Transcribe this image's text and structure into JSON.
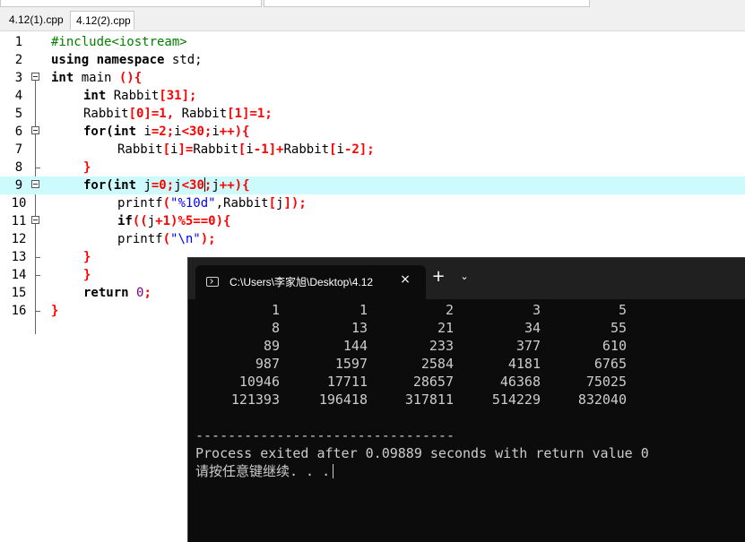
{
  "tabs": [
    {
      "label": "4.12(1).cpp",
      "active": false
    },
    {
      "label": "4.12(2).cpp",
      "active": true
    }
  ],
  "editor": {
    "current_line": 9,
    "lines": [
      {
        "num": "1",
        "fold": "none"
      },
      {
        "num": "2",
        "fold": "none"
      },
      {
        "num": "3",
        "fold": "open"
      },
      {
        "num": "4",
        "fold": "none"
      },
      {
        "num": "5",
        "fold": "none"
      },
      {
        "num": "6",
        "fold": "open"
      },
      {
        "num": "7",
        "fold": "none"
      },
      {
        "num": "8",
        "fold": "end"
      },
      {
        "num": "9",
        "fold": "open"
      },
      {
        "num": "10",
        "fold": "none"
      },
      {
        "num": "11",
        "fold": "open"
      },
      {
        "num": "12",
        "fold": "none"
      },
      {
        "num": "13",
        "fold": "end"
      },
      {
        "num": "14",
        "fold": "end"
      },
      {
        "num": "15",
        "fold": "none"
      },
      {
        "num": "16",
        "fold": "end"
      }
    ],
    "code": {
      "l1_include": "#include<iostream>",
      "l2_using": "using namespace",
      "l2_std": " std;",
      "l3_int": "int",
      "l3_main": " main ",
      "l3_brace": "(){",
      "l4_int": "int",
      "l4_rest_a": " Rabbit",
      "l4_bracket": "[31];",
      "l5_a": "Rabbit",
      "l5_b": "[0]=1,",
      "l5_c": " Rabbit",
      "l5_d": "[1]=1;",
      "l6_for": "for(int",
      "l6_i": " i",
      "l6_a": "=2;",
      "l6_b": "i",
      "l6_c": "<30;",
      "l6_d": "i",
      "l6_e": "++){",
      "l7_a": "Rabbit",
      "l7_b": "[",
      "l7_c": "i",
      "l7_d": "]=",
      "l7_e": "Rabbit",
      "l7_f": "[",
      "l7_g": "i",
      "l7_h": "-1]+",
      "l7_i": "Rabbit",
      "l7_j": "[",
      "l7_k": "i",
      "l7_l": "-2];",
      "l8_close": "}",
      "l9_for": "for(int",
      "l9_j": " j",
      "l9_a": "=0;",
      "l9_b": "j",
      "l9_c": "<30",
      "l9_d": ";",
      "l9_e": "j",
      "l9_f": "++){",
      "l10_printf": "printf",
      "l10_open": "(",
      "l10_str": "\"%10d\"",
      "l10_comma": ",Rabbit",
      "l10_bracket": "[",
      "l10_j": "j",
      "l10_close": "]);",
      "l11_if": "if",
      "l11_a": "((",
      "l11_j": "j",
      "l11_b": "+1)%5==0){",
      "l12_printf": "printf",
      "l12_open": "(",
      "l12_str": "\"\\n\"",
      "l12_close": ");",
      "l13_close": "}",
      "l14_close": "}",
      "l15_return": "return",
      "l15_zero": " 0",
      "l15_semi": ";",
      "l16_close": "}"
    }
  },
  "console": {
    "title": "C:\\Users\\李家旭\\Desktop\\4.12",
    "close_icon": "×",
    "new_tab_icon": "+",
    "dropdown_icon": "⌄",
    "rows": [
      [
        "1",
        "1",
        "2",
        "3",
        "5"
      ],
      [
        "8",
        "13",
        "21",
        "34",
        "55"
      ],
      [
        "89",
        "144",
        "233",
        "377",
        "610"
      ],
      [
        "987",
        "1597",
        "2584",
        "4181",
        "6765"
      ],
      [
        "10946",
        "17711",
        "28657",
        "46368",
        "75025"
      ],
      [
        "121393",
        "196418",
        "317811",
        "514229",
        "832040"
      ]
    ],
    "separator": "--------------------------------",
    "exit_message": "Process exited after 0.09889 seconds with return value 0",
    "prompt": "请按任意键继续. . ."
  }
}
